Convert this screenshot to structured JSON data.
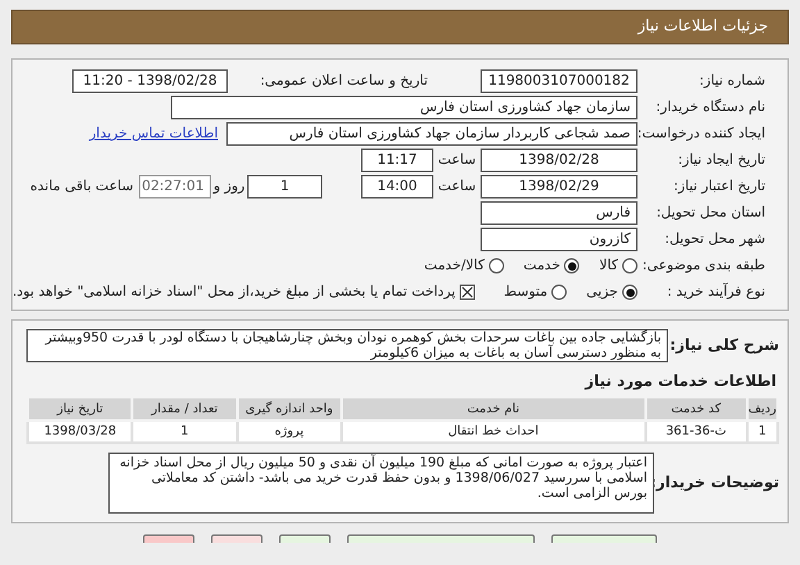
{
  "header": {
    "title": "جزئیات اطلاعات نیاز"
  },
  "need_number": {
    "label": "شماره نیاز:",
    "value": "1198003107000182"
  },
  "announce": {
    "label": "تاریخ و ساعت اعلان عمومی:",
    "value": "1398/02/28 - 11:20"
  },
  "buyer_org": {
    "label": "نام دستگاه خریدار:",
    "value": "سازمان جهاد کشاورزی استان فارس"
  },
  "requester": {
    "label": "ایجاد کننده درخواست:",
    "value": "صمد شجاعی کاربردار سازمان جهاد کشاورزی استان فارس",
    "link": "اطلاعات تماس خریدار"
  },
  "created": {
    "label": "تاریخ ایجاد نیاز:",
    "date": "1398/02/28",
    "time_label": "ساعت",
    "time": "11:17"
  },
  "validity": {
    "label": "تاریخ اعتبار نیاز:",
    "date": "1398/02/29",
    "time_label": "ساعت",
    "time": "14:00",
    "days": "1",
    "days_label": "روز و",
    "remaining": "02:27:01",
    "remaining_label": "ساعت باقی مانده"
  },
  "province": {
    "label": "استان محل تحویل:",
    "value": "فارس"
  },
  "city": {
    "label": "شهر محل تحویل:",
    "value": "کازرون"
  },
  "category": {
    "label": "طبقه بندی موضوعی:",
    "options": [
      {
        "label": "کالا",
        "selected": false
      },
      {
        "label": "خدمت",
        "selected": true
      },
      {
        "label": "کالا/خدمت",
        "selected": false
      }
    ]
  },
  "process": {
    "label": "نوع فرآیند خرید :",
    "options": [
      {
        "label": "جزیی",
        "selected": true
      },
      {
        "label": "متوسط",
        "selected": false
      }
    ],
    "treasury": {
      "checked": true,
      "text": "پرداخت تمام یا بخشی از مبلغ خرید،از محل \"اسناد خزانه اسلامی\" خواهد بود."
    }
  },
  "description": {
    "label": "شرح کلی نیاز:",
    "text": "بازگشایی جاده بین باغات سرحدات بخش کوهمره نودان وبخش چنارشاهیجان  با دستگاه لودر با قدرت 950وبیشتر به منظور دسترسی آسان به باغات  به میزان 6کیلومتر"
  },
  "services": {
    "title": "اطلاعات خدمات مورد نیاز",
    "columns": [
      "ردیف",
      "کد خدمت",
      "نام خدمت",
      "واحد اندازه گیری",
      "تعداد / مقدار",
      "تاریخ نیاز"
    ],
    "rows": [
      [
        "1",
        "ث-36-361",
        "احداث خط انتقال",
        "پروژه",
        "1",
        "1398/03/28"
      ]
    ]
  },
  "notes": {
    "label": "توضیحات خریدار:",
    "text": "اعتبار پروژه به صورت امانی که مبلغ 190 میلیون آن نقدی و 50 میلیون ریال از محل اسناد خزانه اسلامی با سررسید 1398/06/027 و بدون حفظ قدرت خرید می باشد- داشتن کد معاملاتی بورس الزامی است."
  },
  "buttons": [
    {
      "color": "#e6f5e0"
    },
    {
      "color": "#e6f5e0"
    },
    {
      "color": "#e6f5e0"
    },
    {
      "color": "#f9dede"
    },
    {
      "color": "#f9c8c8"
    }
  ]
}
